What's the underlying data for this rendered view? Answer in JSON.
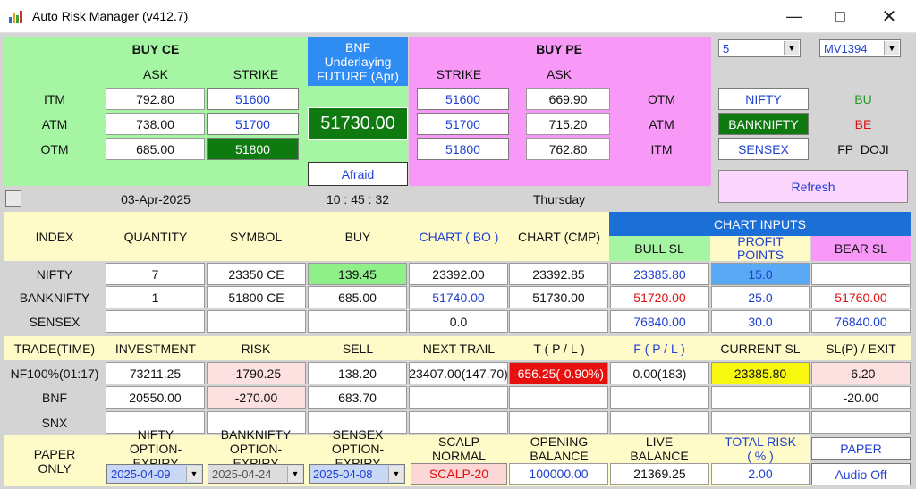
{
  "window": {
    "title": "Auto Risk Manager (v412.7)"
  },
  "buy_ce": {
    "title": "BUY CE",
    "ask_header": "ASK",
    "strike_header": "STRIKE",
    "rows": [
      {
        "label": "ITM",
        "ask": "792.80",
        "strike": "51600"
      },
      {
        "label": "ATM",
        "ask": "738.00",
        "strike": "51700"
      },
      {
        "label": "OTM",
        "ask": "685.00",
        "strike": "51800"
      }
    ]
  },
  "underlying": {
    "label": "BNF Underlaying FUTURE (Apr)",
    "price": "51730.00",
    "sentiment": "Afraid"
  },
  "buy_pe": {
    "title": "BUY PE",
    "strike_header": "STRIKE",
    "ask_header": "ASK",
    "rows": [
      {
        "label": "OTM",
        "strike": "51600",
        "ask": "669.90"
      },
      {
        "label": "ATM",
        "strike": "51700",
        "ask": "715.20"
      },
      {
        "label": "ITM",
        "strike": "51800",
        "ask": "762.80"
      }
    ]
  },
  "right_panel": {
    "lots_select": "5",
    "account_select": "MV1394",
    "nifty_btn": "NIFTY",
    "banknifty_btn": "BANKNIFTY",
    "sensex_btn": "SENSEX",
    "sig1": "BU",
    "sig2": "BE",
    "sig3": "FP_DOJI",
    "refresh": "Refresh"
  },
  "status": {
    "date": "03-Apr-2025",
    "time": "10 : 45 : 32",
    "day": "Thursday"
  },
  "positions": {
    "headers": {
      "index": "INDEX",
      "quantity": "QUANTITY",
      "symbol": "SYMBOL",
      "buy": "BUY",
      "chart_bo": "CHART ( BO )",
      "chart_cmp": "CHART (CMP)",
      "chart_inputs": "CHART INPUTS",
      "bull_sl": "BULL SL",
      "profit_points": "PROFIT POINTS",
      "bear_sl": "BEAR SL"
    },
    "rows": [
      {
        "index": "NIFTY",
        "quantity": "7",
        "symbol": "23350  CE",
        "buy": "139.45",
        "chart_bo": "23392.00",
        "chart_cmp": "23392.85",
        "bull_sl": "23385.80",
        "profit_points": "15.0",
        "bear_sl": ""
      },
      {
        "index": "BANKNIFTY",
        "quantity": "1",
        "symbol": "51800  CE",
        "buy": "685.00",
        "chart_bo": "51740.00",
        "chart_cmp": "51730.00",
        "bull_sl": "51720.00",
        "profit_points": "25.0",
        "bear_sl": "51760.00"
      },
      {
        "index": "SENSEX",
        "quantity": "",
        "symbol": "",
        "buy": "",
        "chart_bo": "0.0",
        "chart_cmp": "",
        "bull_sl": "76840.00",
        "profit_points": "30.0",
        "bear_sl": "76840.00"
      }
    ]
  },
  "trades": {
    "headers": {
      "trade_time": "TRADE(TIME)",
      "investment": "INVESTMENT",
      "risk": "RISK",
      "sell": "SELL",
      "next_trail": "NEXT TRAIL",
      "tpl": "T ( P / L )",
      "fpl": "F ( P / L )",
      "current_sl": "CURRENT SL",
      "slp_exit": "SL(P) / EXIT"
    },
    "rows": [
      {
        "trade_time": "NF100%(01:17)",
        "investment": "73211.25",
        "risk": "-1790.25",
        "sell": "138.20",
        "next_trail": "23407.00(147.70)",
        "tpl": "-656.25(-0.90%)",
        "fpl": "0.00(183)",
        "current_sl": "23385.80",
        "slp_exit": "-6.20"
      },
      {
        "trade_time": "BNF",
        "investment": "20550.00",
        "risk": "-270.00",
        "sell": "683.70",
        "next_trail": "",
        "tpl": "",
        "fpl": "",
        "current_sl": "",
        "slp_exit": "-20.00"
      },
      {
        "trade_time": "SNX",
        "investment": "",
        "risk": "",
        "sell": "",
        "next_trail": "",
        "tpl": "",
        "fpl": "",
        "current_sl": "",
        "slp_exit": ""
      }
    ]
  },
  "bottom": {
    "paper_only": "PAPER ONLY",
    "nifty_expiry_label": "NIFTY OPTION-EXPIRY",
    "nifty_expiry": "2025-04-09",
    "banknifty_expiry_label": "BANKNIFTY OPTION-EXPIRY",
    "banknifty_expiry": "2025-04-24",
    "sensex_expiry_label": "SENSEX OPTION-EXPIRY",
    "sensex_expiry": "2025-04-08",
    "scalp_label": "SCALP NORMAL",
    "scalp_value": "SCALP-20",
    "opening_label": "OPENING BALANCE",
    "opening_value": "100000.00",
    "live_label": "LIVE BALANCE",
    "live_value": "21369.25",
    "risk_label": "TOTAL RISK ( % )",
    "risk_value": "2.00",
    "paper_btn": "PAPER",
    "audio_btn": "Audio Off"
  }
}
